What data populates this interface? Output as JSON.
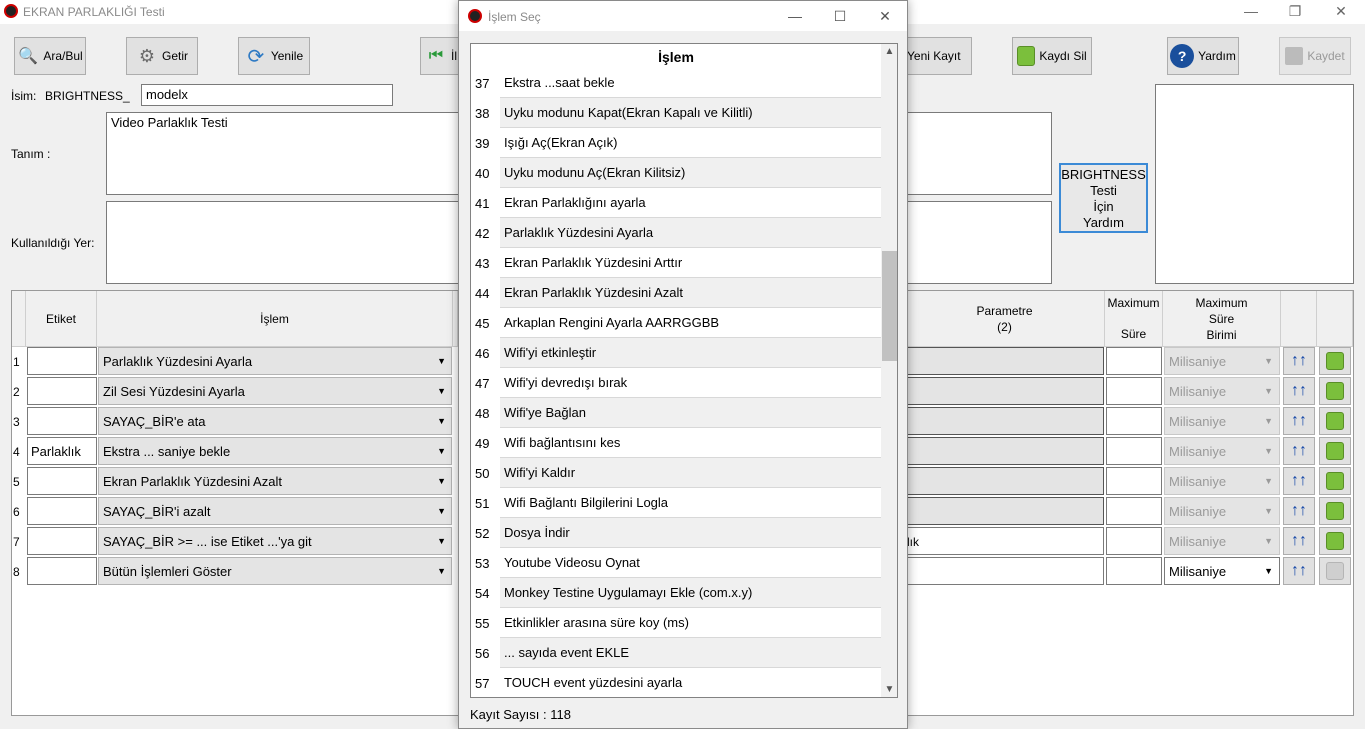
{
  "window": {
    "title": "EKRAN PARLAKLIĞI Testi"
  },
  "toolbar": {
    "search": "Ara/Bul",
    "fetch": "Getir",
    "refresh": "Yenile",
    "first": "İl",
    "new": "Yeni Kayıt",
    "delete": "Kaydı Sil",
    "help": "Yardım",
    "save": "Kaydet"
  },
  "form": {
    "name_label": "İsim:",
    "name_prefix": "BRIGHTNESS_",
    "name_value": "modelx",
    "def_label": "Tanım :",
    "def_value": "Video Parlaklık Testi",
    "used_label": "Kullanıldığı Yer:"
  },
  "help_box": {
    "line1": "BRIGHTNESS",
    "line2": "Testi",
    "line3": "İçin",
    "line4": "Yardım"
  },
  "grid": {
    "headers": {
      "etiket": "Etiket",
      "islem": "İşlem",
      "param2": "Parametre",
      "param2b": "(2)",
      "maxTime": "Maximum",
      "maxTimeB": "Süre",
      "maxUnit": "Maximum",
      "maxUnitB": "Süre",
      "maxUnitC": "Birimi"
    },
    "rows": [
      {
        "no": "1",
        "etiket": "",
        "islem": "Parlaklık Yüzdesini Ayarla",
        "param2": "",
        "unit": "Milisaniye"
      },
      {
        "no": "2",
        "etiket": "",
        "islem": "Zil Sesi Yüzdesini Ayarla",
        "param2": "",
        "unit": "Milisaniye"
      },
      {
        "no": "3",
        "etiket": "",
        "islem": "SAYAÇ_BİR'e ata",
        "param2": "",
        "unit": "Milisaniye"
      },
      {
        "no": "4",
        "etiket": "Parlaklık",
        "islem": "Ekstra ... saniye bekle",
        "param2": "",
        "unit": "Milisaniye"
      },
      {
        "no": "5",
        "etiket": "",
        "islem": "Ekran Parlaklık Yüzdesini Azalt",
        "param2": "",
        "unit": "Milisaniye"
      },
      {
        "no": "6",
        "etiket": "",
        "islem": "SAYAÇ_BİR'i azalt",
        "param2": "",
        "unit": "Milisaniye"
      },
      {
        "no": "7",
        "etiket": "",
        "islem": "SAYAÇ_BİR >= ... ise Etiket ...'ya git",
        "param2": "lık",
        "unit": "Milisaniye"
      },
      {
        "no": "8",
        "etiket": "",
        "islem": "Bütün İşlemleri Göster",
        "param2": "",
        "unit": "Milisaniye"
      }
    ]
  },
  "dialog": {
    "title": "İşlem Seç",
    "header": "İşlem",
    "items": [
      {
        "no": "37",
        "text": "Ekstra ...saat bekle"
      },
      {
        "no": "38",
        "text": "Uyku modunu Kapat(Ekran Kapalı ve Kilitli)"
      },
      {
        "no": "39",
        "text": "Işığı Aç(Ekran Açık)"
      },
      {
        "no": "40",
        "text": "Uyku modunu Aç(Ekran Kilitsiz)"
      },
      {
        "no": "41",
        "text": "Ekran Parlaklığını ayarla"
      },
      {
        "no": "42",
        "text": "Parlaklık Yüzdesini Ayarla"
      },
      {
        "no": "43",
        "text": "Ekran Parlaklık Yüzdesini Arttır"
      },
      {
        "no": "44",
        "text": "Ekran Parlaklık Yüzdesini Azalt"
      },
      {
        "no": "45",
        "text": "Arkaplan Rengini Ayarla AARRGGBB"
      },
      {
        "no": "46",
        "text": "Wifi'yi etkinleştir"
      },
      {
        "no": "47",
        "text": "Wifi'yi devredışı bırak"
      },
      {
        "no": "48",
        "text": "Wifi'ye Bağlan"
      },
      {
        "no": "49",
        "text": "Wifi bağlantısını kes"
      },
      {
        "no": "50",
        "text": "Wifi'yi Kaldır"
      },
      {
        "no": "51",
        "text": "Wifi Bağlantı Bilgilerini Logla"
      },
      {
        "no": "52",
        "text": "Dosya İndir"
      },
      {
        "no": "53",
        "text": "Youtube Videosu Oynat"
      },
      {
        "no": "54",
        "text": "Monkey Testine Uygulamayı Ekle (com.x.y)"
      },
      {
        "no": "55",
        "text": "Etkinlikler arasına süre koy (ms)"
      },
      {
        "no": "56",
        "text": "... sayıda event EKLE"
      },
      {
        "no": "57",
        "text": "TOUCH event yüzdesini ayarla"
      }
    ],
    "count_label": "Kayıt Sayısı :",
    "count_value": "118"
  }
}
